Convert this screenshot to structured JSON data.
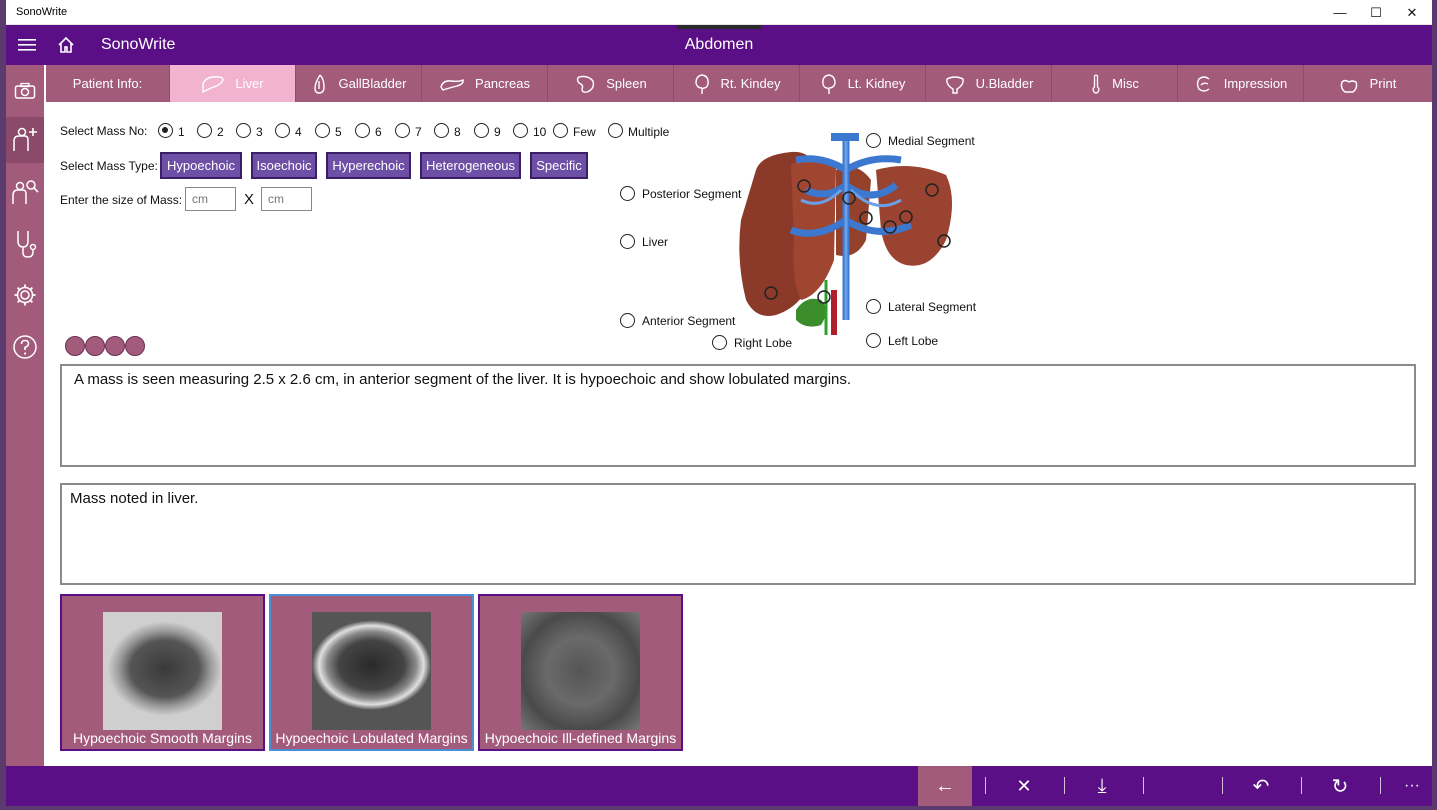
{
  "window": {
    "title": "SonoWrite",
    "minimize": "—",
    "maximize": "☐",
    "close": "✕"
  },
  "appbar": {
    "app_name": "SonoWrite",
    "section": "Abdomen"
  },
  "tabs": [
    {
      "label": "Patient Info:",
      "icon": "none"
    },
    {
      "label": "Liver",
      "icon": "liver-icon"
    },
    {
      "label": "GallBladder",
      "icon": "gallbladder-icon"
    },
    {
      "label": "Pancreas",
      "icon": "pancreas-icon"
    },
    {
      "label": "Spleen",
      "icon": "spleen-icon"
    },
    {
      "label": "Rt. Kindey",
      "icon": "kidney-icon"
    },
    {
      "label": "Lt. Kidney",
      "icon": "kidney-icon"
    },
    {
      "label": "U.Bladder",
      "icon": "bladder-icon"
    },
    {
      "label": "Misc",
      "icon": "thermometer-icon"
    },
    {
      "label": "Impression",
      "icon": "impression-icon"
    },
    {
      "label": "Print",
      "icon": "print-icon"
    }
  ],
  "mass": {
    "select_no_label": "Select Mass No:",
    "options": [
      "1",
      "2",
      "3",
      "4",
      "5",
      "6",
      "7",
      "8",
      "9",
      "10",
      "Few",
      "Multiple"
    ],
    "selected": "1",
    "type_label": "Select Mass Type:",
    "types": [
      "Hypoechoic",
      "Isoechoic",
      "Hyperechoic",
      "Heterogeneous",
      "Specific"
    ],
    "size_label": "Enter the size of Mass:",
    "size_placeholder": "cm",
    "size_sep": "X"
  },
  "segments": {
    "medial": "Medial Segment",
    "posterior": "Posterior Segment",
    "liver": "Liver",
    "anterior": "Anterior Segment",
    "right_lobe": "Right Lobe",
    "lateral": "Lateral Segment",
    "left_lobe": "Left Lobe"
  },
  "findings_text": "A mass is seen measuring 2.5 x 2.6 cm, in anterior segment of the liver. It is hypoechoic and show lobulated margins.",
  "impression_text": "Mass noted in liver.",
  "thumbnails": [
    {
      "caption": "Hypoechoic Smooth Margins"
    },
    {
      "caption": "Hypoechoic Lobulated Margins",
      "selected": true
    },
    {
      "caption": "Hypoechoic Ill-defined Margins"
    }
  ],
  "bottom": {
    "back": "←",
    "clear": "✕",
    "download": "⤓",
    "undo": "↶",
    "refresh": "↻",
    "more": "···"
  }
}
